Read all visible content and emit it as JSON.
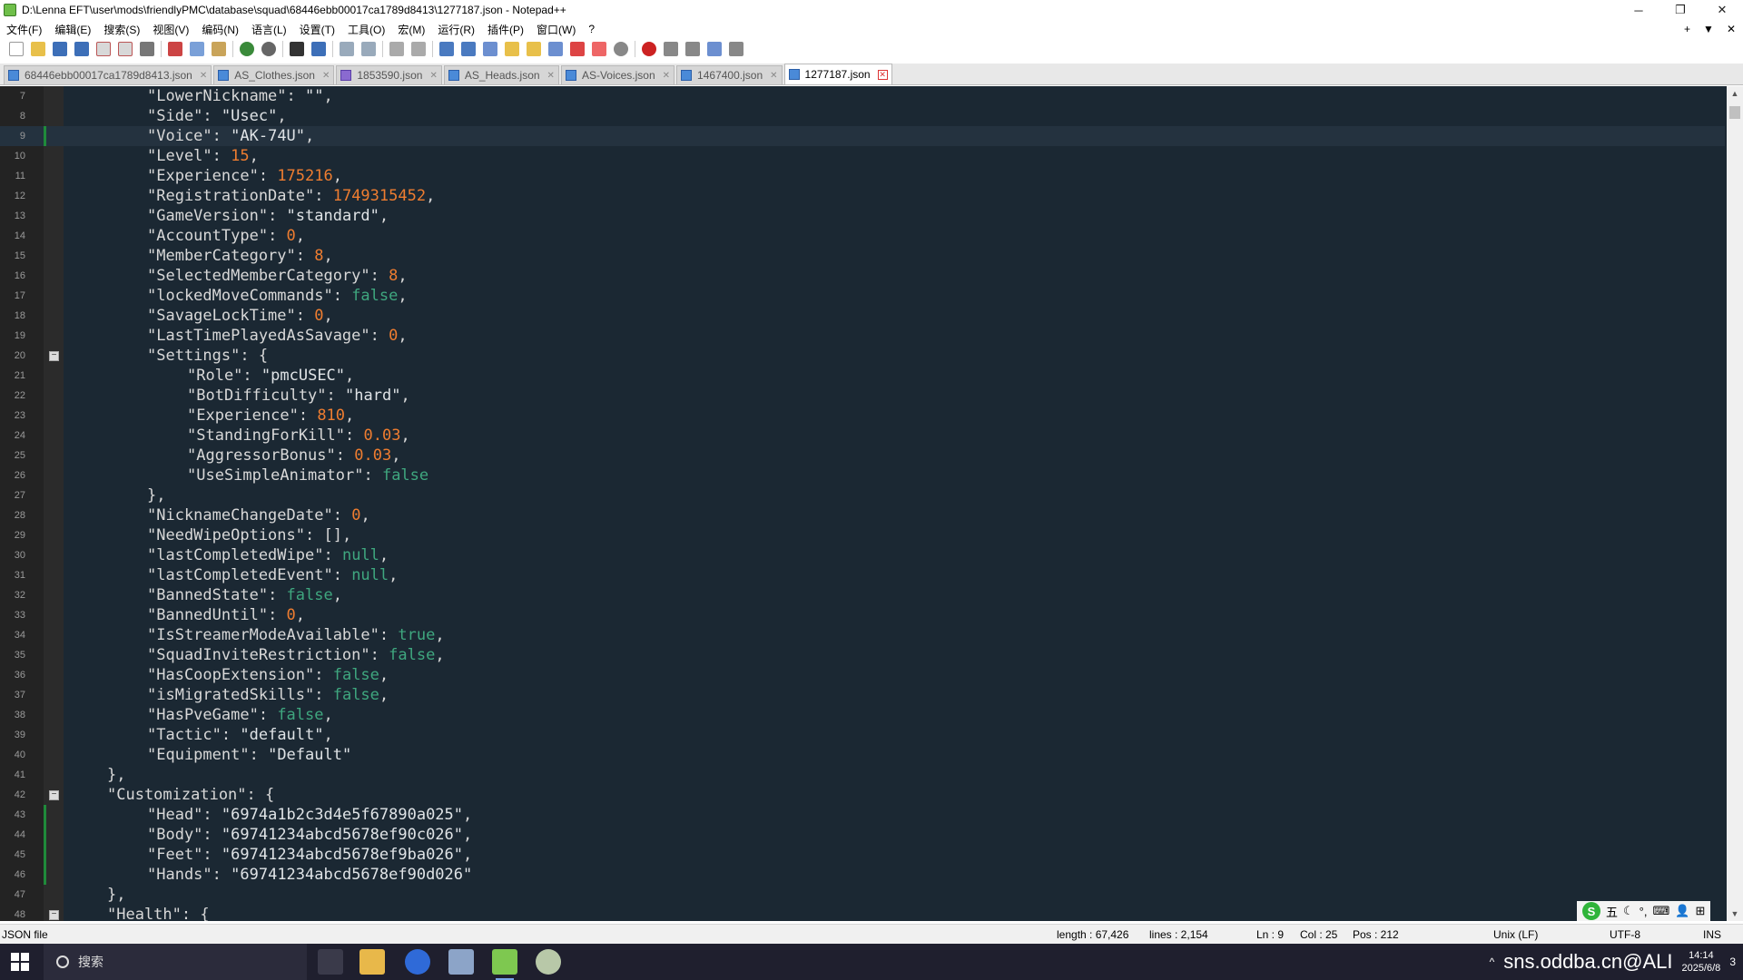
{
  "window": {
    "title": "D:\\Lenna EFT\\user\\mods\\friendlyPMC\\database\\squad\\68446ebb00017ca1789d8413\\1277187.json - Notepad++",
    "controls": [
      "─",
      "❐",
      "✕"
    ]
  },
  "menu": {
    "items": [
      "文件(F)",
      "编辑(E)",
      "搜索(S)",
      "视图(V)",
      "编码(N)",
      "语言(L)",
      "设置(T)",
      "工具(O)",
      "宏(M)",
      "运行(R)",
      "插件(P)",
      "窗口(W)",
      "?"
    ],
    "right": [
      "+",
      "▼",
      "✕"
    ]
  },
  "tabs": [
    {
      "label": "68446ebb00017ca1789d8413.json",
      "active": false
    },
    {
      "label": "AS_Clothes.json",
      "active": false
    },
    {
      "label": "1853590.json",
      "active": false
    },
    {
      "label": "AS_Heads.json",
      "active": false
    },
    {
      "label": "AS-Voices.json",
      "active": false
    },
    {
      "label": "1467400.json",
      "active": false
    },
    {
      "label": "1277187.json",
      "active": true
    }
  ],
  "editor": {
    "current_line": 9,
    "lines": [
      {
        "n": "7",
        "indent": 2,
        "tokens": [
          [
            "key",
            "\"LowerNickname\""
          ],
          [
            "p",
            ": "
          ],
          [
            "str",
            "\"\""
          ],
          [
            "p",
            ","
          ]
        ]
      },
      {
        "n": "8",
        "indent": 2,
        "tokens": [
          [
            "key",
            "\"Side\""
          ],
          [
            "p",
            ": "
          ],
          [
            "str",
            "\"Usec\""
          ],
          [
            "p",
            ","
          ]
        ]
      },
      {
        "n": "9",
        "indent": 2,
        "changed": true,
        "tokens": [
          [
            "key",
            "\"Voice\""
          ],
          [
            "p",
            ": "
          ],
          [
            "str",
            "\"AK-74U\""
          ],
          [
            "p",
            ","
          ]
        ]
      },
      {
        "n": "10",
        "indent": 2,
        "tokens": [
          [
            "key",
            "\"Level\""
          ],
          [
            "p",
            ": "
          ],
          [
            "num",
            "15"
          ],
          [
            "p",
            ","
          ]
        ]
      },
      {
        "n": "11",
        "indent": 2,
        "tokens": [
          [
            "key",
            "\"Experience\""
          ],
          [
            "p",
            ": "
          ],
          [
            "num",
            "175216"
          ],
          [
            "p",
            ","
          ]
        ]
      },
      {
        "n": "12",
        "indent": 2,
        "tokens": [
          [
            "key",
            "\"RegistrationDate\""
          ],
          [
            "p",
            ": "
          ],
          [
            "num",
            "1749315452"
          ],
          [
            "p",
            ","
          ]
        ]
      },
      {
        "n": "13",
        "indent": 2,
        "tokens": [
          [
            "key",
            "\"GameVersion\""
          ],
          [
            "p",
            ": "
          ],
          [
            "str",
            "\"standard\""
          ],
          [
            "p",
            ","
          ]
        ]
      },
      {
        "n": "14",
        "indent": 2,
        "tokens": [
          [
            "key",
            "\"AccountType\""
          ],
          [
            "p",
            ": "
          ],
          [
            "num",
            "0"
          ],
          [
            "p",
            ","
          ]
        ]
      },
      {
        "n": "15",
        "indent": 2,
        "tokens": [
          [
            "key",
            "\"MemberCategory\""
          ],
          [
            "p",
            ": "
          ],
          [
            "num",
            "8"
          ],
          [
            "p",
            ","
          ]
        ]
      },
      {
        "n": "16",
        "indent": 2,
        "tokens": [
          [
            "key",
            "\"SelectedMemberCategory\""
          ],
          [
            "p",
            ": "
          ],
          [
            "num",
            "8"
          ],
          [
            "p",
            ","
          ]
        ]
      },
      {
        "n": "17",
        "indent": 2,
        "tokens": [
          [
            "key",
            "\"lockedMoveCommands\""
          ],
          [
            "p",
            ": "
          ],
          [
            "kw",
            "false"
          ],
          [
            "p",
            ","
          ]
        ]
      },
      {
        "n": "18",
        "indent": 2,
        "tokens": [
          [
            "key",
            "\"SavageLockTime\""
          ],
          [
            "p",
            ": "
          ],
          [
            "num",
            "0"
          ],
          [
            "p",
            ","
          ]
        ]
      },
      {
        "n": "19",
        "indent": 2,
        "tokens": [
          [
            "key",
            "\"LastTimePlayedAsSavage\""
          ],
          [
            "p",
            ": "
          ],
          [
            "num",
            "0"
          ],
          [
            "p",
            ","
          ]
        ]
      },
      {
        "n": "20",
        "indent": 2,
        "fold": true,
        "tokens": [
          [
            "key",
            "\"Settings\""
          ],
          [
            "p",
            ": {"
          ]
        ]
      },
      {
        "n": "21",
        "indent": 3,
        "tokens": [
          [
            "key",
            "\"Role\""
          ],
          [
            "p",
            ": "
          ],
          [
            "str",
            "\"pmcUSEC\""
          ],
          [
            "p",
            ","
          ]
        ]
      },
      {
        "n": "22",
        "indent": 3,
        "tokens": [
          [
            "key",
            "\"BotDifficulty\""
          ],
          [
            "p",
            ": "
          ],
          [
            "str",
            "\"hard\""
          ],
          [
            "p",
            ","
          ]
        ]
      },
      {
        "n": "23",
        "indent": 3,
        "tokens": [
          [
            "key",
            "\"Experience\""
          ],
          [
            "p",
            ": "
          ],
          [
            "num",
            "810"
          ],
          [
            "p",
            ","
          ]
        ]
      },
      {
        "n": "24",
        "indent": 3,
        "tokens": [
          [
            "key",
            "\"StandingForKill\""
          ],
          [
            "p",
            ": "
          ],
          [
            "num",
            "0.03"
          ],
          [
            "p",
            ","
          ]
        ]
      },
      {
        "n": "25",
        "indent": 3,
        "tokens": [
          [
            "key",
            "\"AggressorBonus\""
          ],
          [
            "p",
            ": "
          ],
          [
            "num",
            "0.03"
          ],
          [
            "p",
            ","
          ]
        ]
      },
      {
        "n": "26",
        "indent": 3,
        "tokens": [
          [
            "key",
            "\"UseSimpleAnimator\""
          ],
          [
            "p",
            ": "
          ],
          [
            "kw",
            "false"
          ]
        ]
      },
      {
        "n": "27",
        "indent": 2,
        "tokens": [
          [
            "p",
            "},"
          ]
        ]
      },
      {
        "n": "28",
        "indent": 2,
        "tokens": [
          [
            "key",
            "\"NicknameChangeDate\""
          ],
          [
            "p",
            ": "
          ],
          [
            "num",
            "0"
          ],
          [
            "p",
            ","
          ]
        ]
      },
      {
        "n": "29",
        "indent": 2,
        "tokens": [
          [
            "key",
            "\"NeedWipeOptions\""
          ],
          [
            "p",
            ": [],"
          ]
        ]
      },
      {
        "n": "30",
        "indent": 2,
        "tokens": [
          [
            "key",
            "\"lastCompletedWipe\""
          ],
          [
            "p",
            ": "
          ],
          [
            "kw",
            "null"
          ],
          [
            "p",
            ","
          ]
        ]
      },
      {
        "n": "31",
        "indent": 2,
        "tokens": [
          [
            "key",
            "\"lastCompletedEvent\""
          ],
          [
            "p",
            ": "
          ],
          [
            "kw",
            "null"
          ],
          [
            "p",
            ","
          ]
        ]
      },
      {
        "n": "32",
        "indent": 2,
        "tokens": [
          [
            "key",
            "\"BannedState\""
          ],
          [
            "p",
            ": "
          ],
          [
            "kw",
            "false"
          ],
          [
            "p",
            ","
          ]
        ]
      },
      {
        "n": "33",
        "indent": 2,
        "tokens": [
          [
            "key",
            "\"BannedUntil\""
          ],
          [
            "p",
            ": "
          ],
          [
            "num",
            "0"
          ],
          [
            "p",
            ","
          ]
        ]
      },
      {
        "n": "34",
        "indent": 2,
        "tokens": [
          [
            "key",
            "\"IsStreamerModeAvailable\""
          ],
          [
            "p",
            ": "
          ],
          [
            "kw",
            "true"
          ],
          [
            "p",
            ","
          ]
        ]
      },
      {
        "n": "35",
        "indent": 2,
        "tokens": [
          [
            "key",
            "\"SquadInviteRestriction\""
          ],
          [
            "p",
            ": "
          ],
          [
            "kw",
            "false"
          ],
          [
            "p",
            ","
          ]
        ]
      },
      {
        "n": "36",
        "indent": 2,
        "tokens": [
          [
            "key",
            "\"HasCoopExtension\""
          ],
          [
            "p",
            ": "
          ],
          [
            "kw",
            "false"
          ],
          [
            "p",
            ","
          ]
        ]
      },
      {
        "n": "37",
        "indent": 2,
        "tokens": [
          [
            "key",
            "\"isMigratedSkills\""
          ],
          [
            "p",
            ": "
          ],
          [
            "kw",
            "false"
          ],
          [
            "p",
            ","
          ]
        ]
      },
      {
        "n": "38",
        "indent": 2,
        "tokens": [
          [
            "key",
            "\"HasPveGame\""
          ],
          [
            "p",
            ": "
          ],
          [
            "kw",
            "false"
          ],
          [
            "p",
            ","
          ]
        ]
      },
      {
        "n": "39",
        "indent": 2,
        "tokens": [
          [
            "key",
            "\"Tactic\""
          ],
          [
            "p",
            ": "
          ],
          [
            "str",
            "\"default\""
          ],
          [
            "p",
            ","
          ]
        ]
      },
      {
        "n": "40",
        "indent": 2,
        "tokens": [
          [
            "key",
            "\"Equipment\""
          ],
          [
            "p",
            ": "
          ],
          [
            "str",
            "\"Default\""
          ]
        ]
      },
      {
        "n": "41",
        "indent": 1,
        "tokens": [
          [
            "p",
            "},"
          ]
        ]
      },
      {
        "n": "42",
        "indent": 1,
        "fold": true,
        "tokens": [
          [
            "key",
            "\"Customization\""
          ],
          [
            "p",
            ": {"
          ]
        ]
      },
      {
        "n": "43",
        "indent": 2,
        "changed": true,
        "tokens": [
          [
            "key",
            "\"Head\""
          ],
          [
            "p",
            ": "
          ],
          [
            "str",
            "\"6974a1b2c3d4e5f67890a025\""
          ],
          [
            "p",
            ","
          ]
        ]
      },
      {
        "n": "44",
        "indent": 2,
        "changed": true,
        "tokens": [
          [
            "key",
            "\"Body\""
          ],
          [
            "p",
            ": "
          ],
          [
            "str",
            "\"69741234abcd5678ef90c026\""
          ],
          [
            "p",
            ","
          ]
        ]
      },
      {
        "n": "45",
        "indent": 2,
        "changed": true,
        "tokens": [
          [
            "key",
            "\"Feet\""
          ],
          [
            "p",
            ": "
          ],
          [
            "str",
            "\"69741234abcd5678ef9ba026\""
          ],
          [
            "p",
            ","
          ]
        ]
      },
      {
        "n": "46",
        "indent": 2,
        "changed": true,
        "tokens": [
          [
            "key",
            "\"Hands\""
          ],
          [
            "p",
            ": "
          ],
          [
            "str",
            "\"69741234abcd5678ef90d026\""
          ]
        ]
      },
      {
        "n": "47",
        "indent": 1,
        "tokens": [
          [
            "p",
            "},"
          ]
        ]
      },
      {
        "n": "48",
        "indent": 1,
        "fold": true,
        "tokens": [
          [
            "key",
            "\"Health\""
          ],
          [
            "p",
            ": {"
          ]
        ]
      }
    ]
  },
  "ime": {
    "items": [
      "五",
      "☾",
      "°,",
      "⌨",
      "👤",
      "⊞"
    ]
  },
  "status": {
    "filetype": "JSON file",
    "length": "length : 67,426",
    "lines": "lines : 2,154",
    "ln": "Ln : 9",
    "col": "Col : 25",
    "pos": "Pos : 212",
    "eol": "Unix (LF)",
    "encoding": "UTF-8",
    "mode": "INS"
  },
  "taskbar": {
    "search_placeholder": "搜索",
    "watermark": "sns.oddba.cn@ALI",
    "time": "14:14",
    "date": "2025/6/8",
    "badge": "3"
  },
  "colors": {
    "editor_bg": "#1b2833",
    "key": "#d8d8d8",
    "number": "#ef7d30",
    "keyword": "#3fa77f",
    "changed_marker": "#1f8a3a"
  }
}
